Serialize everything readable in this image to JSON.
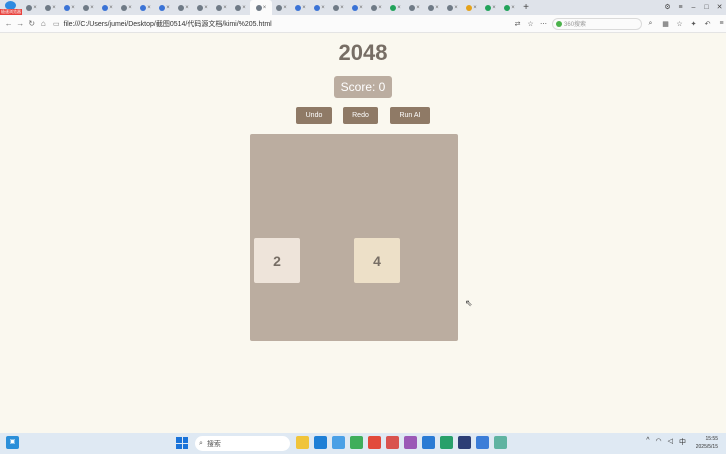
{
  "browser": {
    "logo_text": "极速浏览器",
    "url": "file:///C:/Users/jumei/Desktop/截图0514/代码源文档/kimi/%205.html",
    "search_placeholder": "360搜索",
    "tab_close": "×",
    "new_tab": "+"
  },
  "game": {
    "title": "2048",
    "score_label": "Score: ",
    "score_value": "0",
    "buttons": {
      "undo": "Undo",
      "redo": "Redo",
      "run_ai": "Run AI"
    },
    "grid_size": 4,
    "tiles": [
      {
        "value": "2",
        "row": 2,
        "col": 0,
        "bg": "#eee4da"
      },
      {
        "value": "4",
        "row": 2,
        "col": 2,
        "bg": "#ede0c8"
      }
    ]
  },
  "colors": {
    "background": "#faf8ef",
    "board": "#bbada0",
    "button": "#8f7a66",
    "text": "#776e65"
  },
  "taskbar": {
    "search_label": "搜索",
    "clock_time": "15:55",
    "clock_date": "2025/5/15",
    "input_lang": "中"
  }
}
